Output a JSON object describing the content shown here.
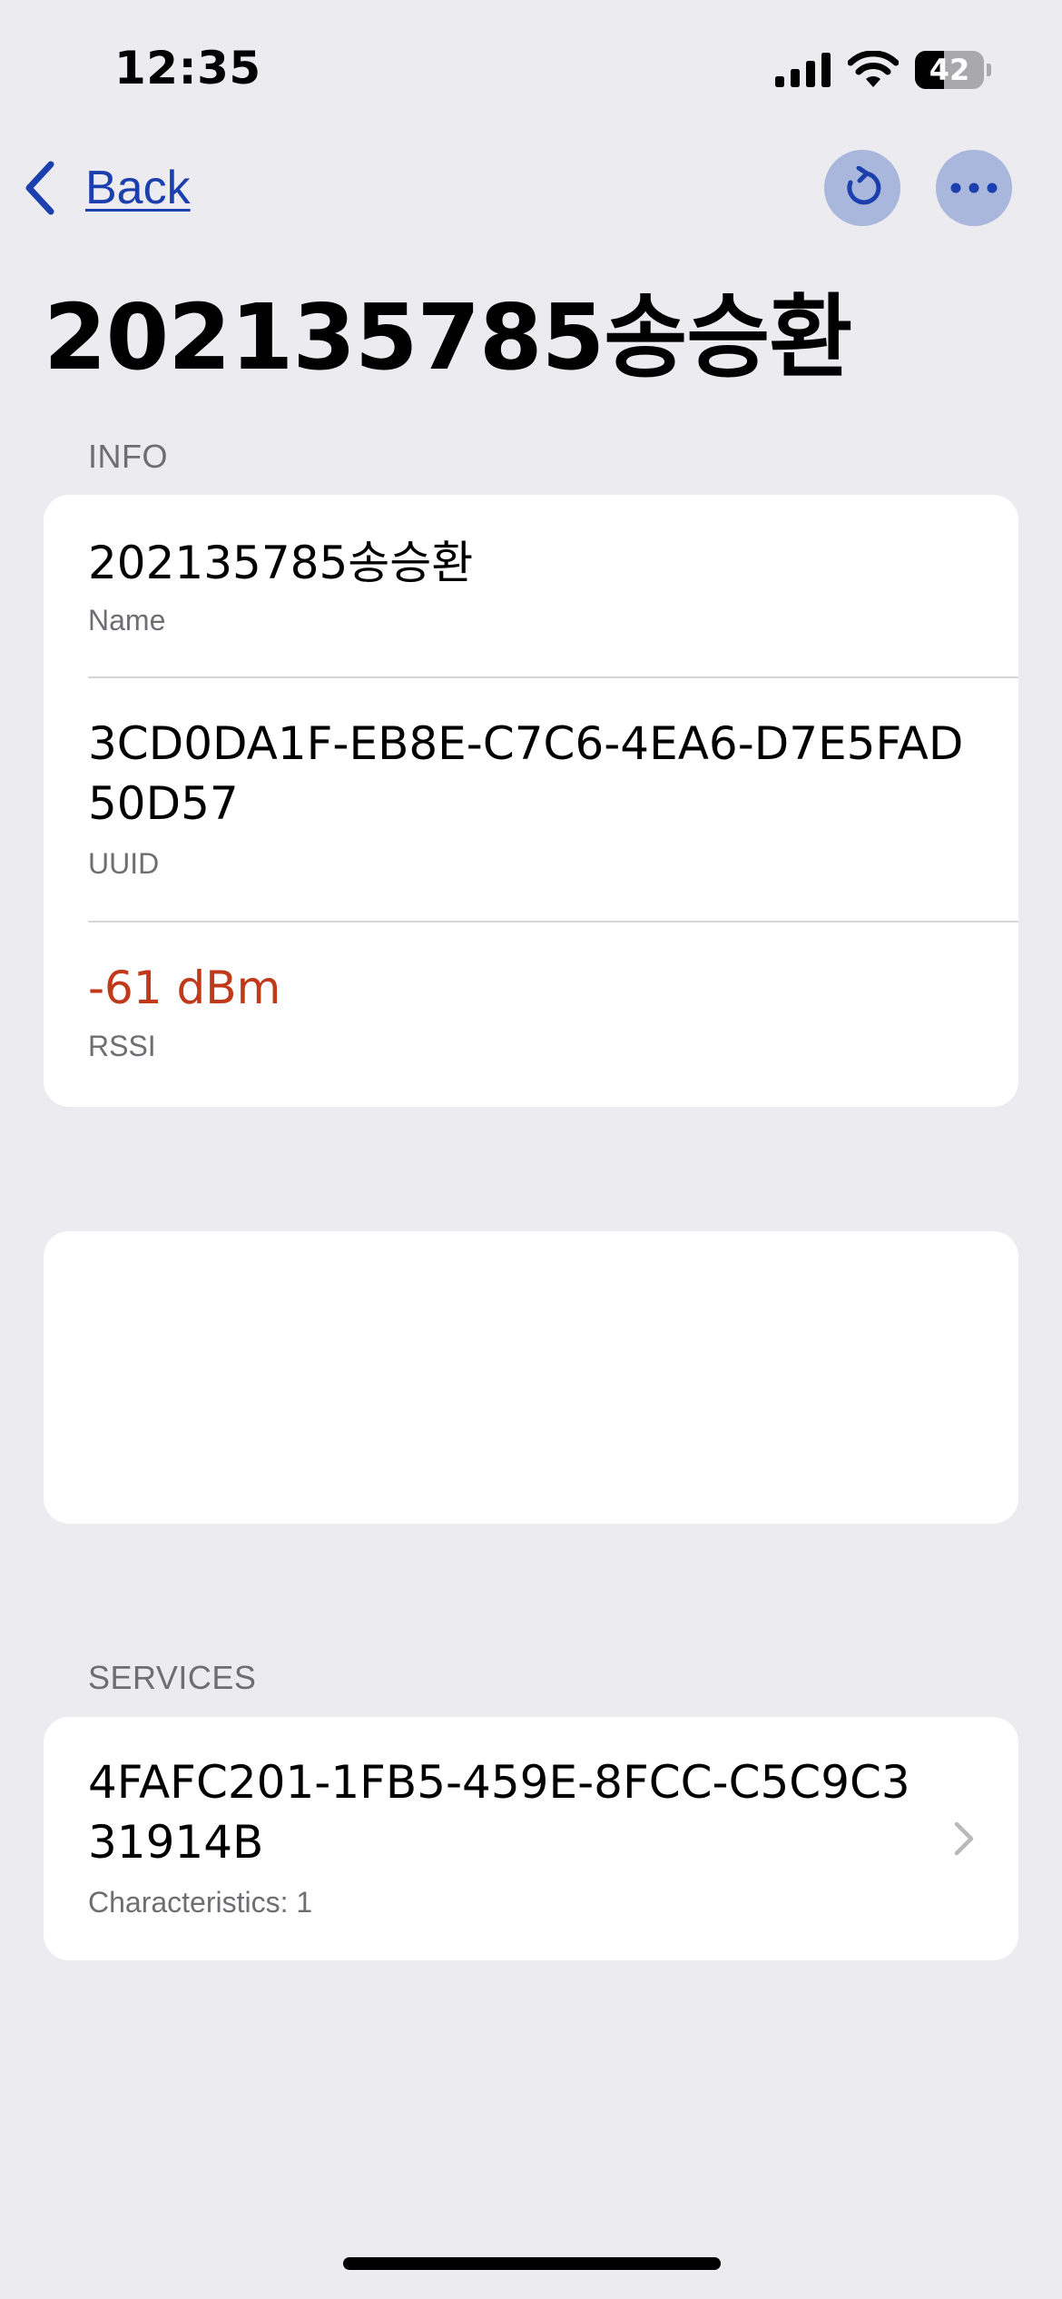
{
  "status_bar": {
    "time": "12:35",
    "battery": "42",
    "battery_level": 0.42
  },
  "nav": {
    "back_label": "Back",
    "refresh_icon": "refresh-icon",
    "more_icon": "more-icon"
  },
  "title": "202135785송승환",
  "info_section": {
    "header": "INFO",
    "rows": [
      {
        "value": "202135785송승환",
        "label": "Name"
      },
      {
        "value_line1": "3CD0DA1F-EB8E-C7C6-4EA6-D7E5FAD",
        "value_line2": "50D57",
        "label": "UUID"
      },
      {
        "value": "-61 dBm",
        "label": "RSSI"
      }
    ]
  },
  "services_section": {
    "header": "SERVICES",
    "items": [
      {
        "uuid_line1": "4FAFC201-1FB5-459E-8FCC-C5C9C3",
        "uuid_line2": "31914B",
        "subtitle": "Characteristics: 1"
      }
    ]
  },
  "colors": {
    "accent": "#1c3fae",
    "rssi": "#c0391b",
    "background": "#ebebf0"
  }
}
